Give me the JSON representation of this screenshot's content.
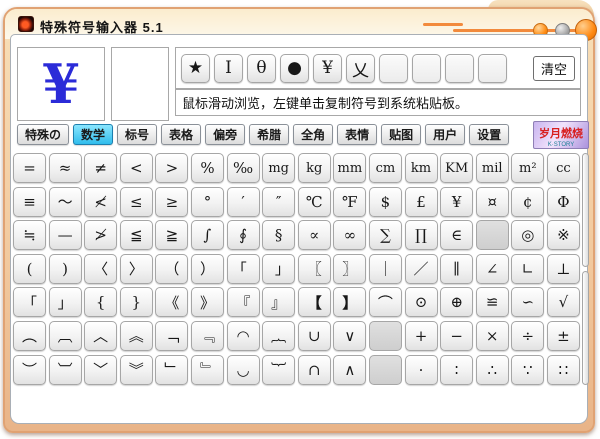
{
  "window": {
    "title": "特殊符号输入器 5.1"
  },
  "titlebar_buttons": {
    "minimize": "minimize",
    "tray": "tray",
    "close": "close"
  },
  "preview": {
    "symbol": "¥"
  },
  "recent": {
    "symbols": [
      "★",
      "I",
      "θ",
      "●",
      "¥",
      "乂",
      "",
      "",
      "",
      ""
    ],
    "clear_label": "清空"
  },
  "instruction": {
    "text": "鼠标滑动浏览，左键单击复制符号到系统粘贴板。"
  },
  "tabs": {
    "selected_index": 1,
    "items": [
      "特殊の",
      "数学",
      "标号",
      "表格",
      "偏旁",
      "希腊",
      "全角",
      "表情",
      "贴图",
      "用户",
      "设置"
    ]
  },
  "logo": {
    "title": "岁月燃烧",
    "subtitle": "K·STORY"
  },
  "colors": {
    "accent_orange": "#f28a3c",
    "selected_tab": "#30bcec",
    "preview_blue": "#2b2bd8",
    "frame": "#e0a273"
  },
  "grid": {
    "rows": [
      [
        "=",
        "≈",
        "≠",
        "<",
        ">",
        "%",
        "‰",
        "mg",
        "kg",
        "mm",
        "cm",
        "km",
        "KM",
        "mil",
        "m²",
        "cc"
      ],
      [
        "≡",
        "～",
        "≮",
        "≤",
        "≥",
        "°",
        "′",
        "″",
        "℃",
        "℉",
        "$",
        "£",
        "¥",
        "¤",
        "¢",
        "Φ"
      ],
      [
        "≒",
        "—",
        "≯",
        "≦",
        "≧",
        "∫",
        "∮",
        "§",
        "∝",
        "∞",
        "∑",
        "∏",
        "∈",
        "",
        "◎",
        "※"
      ],
      [
        "(",
        ")",
        "〈",
        "〉",
        "（",
        "）",
        "｢",
        "｣",
        "〖",
        "〗",
        "｜",
        "／",
        "∥",
        "∠",
        "∟",
        "⊥"
      ],
      [
        "「",
        "」",
        "{",
        "}",
        "《",
        "》",
        "『",
        "』",
        "【",
        "】",
        "⌒",
        "⊙",
        "⊕",
        "≌",
        "∽",
        "√"
      ],
      [
        "︵",
        "︹",
        "︿",
        "︽",
        "﹁",
        "﹃",
        "◠",
        "︷",
        "∪",
        "∨",
        "",
        "+",
        "−",
        "×",
        "÷",
        "±"
      ],
      [
        "︶",
        "︺",
        "﹀",
        "︾",
        "﹂",
        "﹄",
        "◡",
        "︸",
        "∩",
        "∧",
        "",
        "·",
        "∶",
        "∴",
        "∵",
        "∷"
      ]
    ]
  }
}
